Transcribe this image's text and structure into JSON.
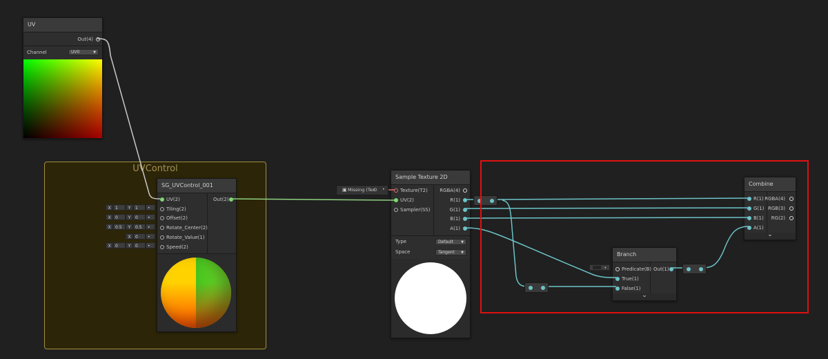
{
  "group": {
    "title": "UVControl"
  },
  "uv_node": {
    "title": "UV",
    "out_label": "Out(4)",
    "channel_label": "Channel",
    "channel_value": "UV0"
  },
  "uvcontrol_node": {
    "title": "SG_UVControl_001",
    "inputs": [
      {
        "label": "UV(2)"
      },
      {
        "label": "Tiling(2)",
        "x": "1",
        "y": "1"
      },
      {
        "label": "Offset(2)",
        "x": "0",
        "y": "0"
      },
      {
        "label": "Rotate_Center(2)",
        "x": "0.5",
        "y": "0.5"
      },
      {
        "label": "Rotate_Value(1)",
        "x": "0"
      },
      {
        "label": "Speed(2)",
        "x": "0",
        "y": "0"
      }
    ],
    "output": "Out(2)"
  },
  "axis_labels": {
    "x": "X",
    "y": "Y"
  },
  "sample_node": {
    "title": "Sample Texture 2D",
    "inputs": [
      "Texture(T2)",
      "UV(2)",
      "Sampler(SS)"
    ],
    "outputs": [
      "RGBA(4)",
      "R(1)",
      "G(1)",
      "B(1)",
      "A(1)"
    ],
    "type_label": "Type",
    "type_value": "Default",
    "space_label": "Space",
    "space_value": "Tangent",
    "missing_text": "Missing (Tex"
  },
  "branch_node": {
    "title": "Branch",
    "inputs": [
      "Predicate(B)",
      "True(1)",
      "False(1)"
    ],
    "output": "Out(1)"
  },
  "combine_node": {
    "title": "Combine",
    "inputs": [
      "R(1)",
      "G(1)",
      "B(1)",
      "A(1)"
    ],
    "outputs": [
      "RGBA(4)",
      "RGB(3)",
      "RG(2)"
    ]
  },
  "colors": {
    "background": "#202020",
    "wire_green": "#8fd17f",
    "wire_cyan": "#6cc3c8",
    "wire_gray": "#c8c8c8",
    "selection": "#e01010",
    "group_border": "#a58f3a"
  }
}
